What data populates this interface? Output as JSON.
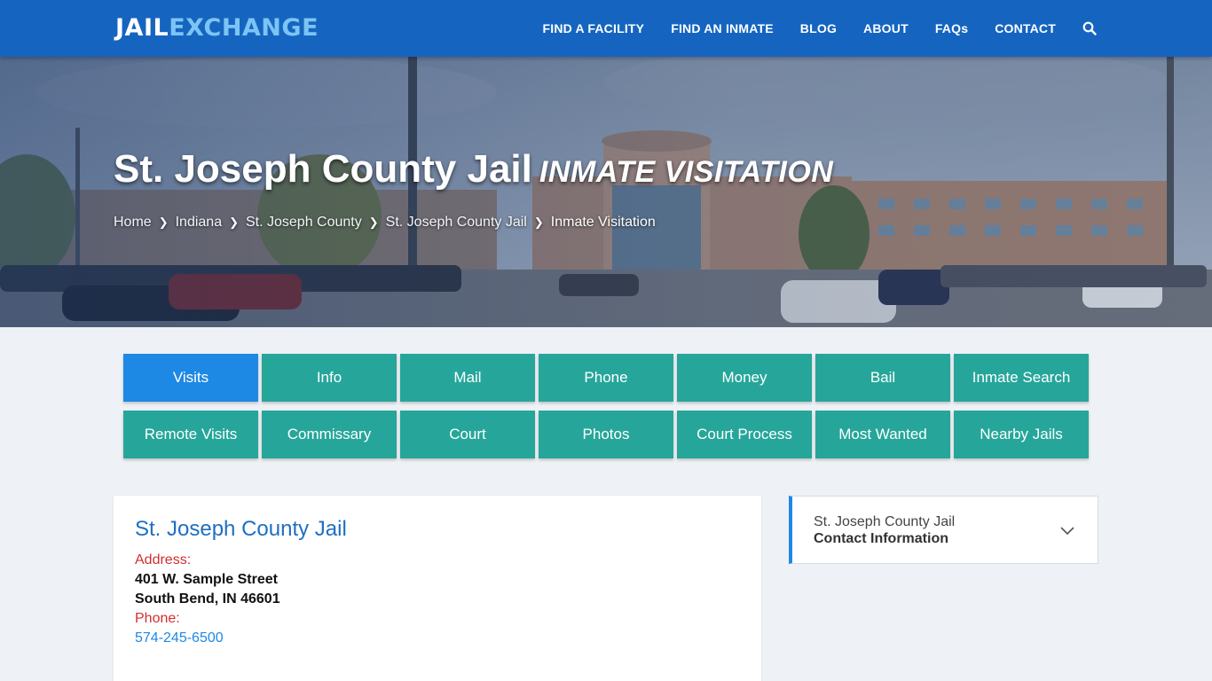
{
  "header": {
    "logo_part1": "JAIL",
    "logo_part2": "EXCHANGE",
    "nav": [
      "FIND A FACILITY",
      "FIND AN INMATE",
      "BLOG",
      "ABOUT",
      "FAQs",
      "CONTACT"
    ],
    "search_icon": "search-icon"
  },
  "hero": {
    "title": "St. Joseph County Jail",
    "subtitle": "INMATE VISITATION",
    "breadcrumbs": [
      "Home",
      "Indiana",
      "St. Joseph County",
      "St. Joseph County Jail",
      "Inmate Visitation"
    ]
  },
  "buttons": {
    "row1": [
      "Visits",
      "Info",
      "Mail",
      "Phone",
      "Money",
      "Bail",
      "Inmate Search"
    ],
    "row2": [
      "Remote Visits",
      "Commissary",
      "Court",
      "Photos",
      "Court Process",
      "Most Wanted",
      "Nearby Jails"
    ],
    "active": "Visits"
  },
  "card": {
    "title": "St. Joseph County Jail",
    "address_label": "Address:",
    "address_line1": "401 W. Sample Street",
    "address_line2": "South Bend, IN 46601",
    "phone_label": "Phone:",
    "phone": "574-245-6500"
  },
  "side": {
    "line1": "St. Joseph County Jail",
    "line2": "Contact Information",
    "chevron_icon": "chevron-down-icon"
  },
  "colors": {
    "header_bg": "#1565c0",
    "button_teal": "#26a69a",
    "button_active": "#1e88e5",
    "label_red": "#d32f2f",
    "link_blue": "#1e88e5"
  }
}
